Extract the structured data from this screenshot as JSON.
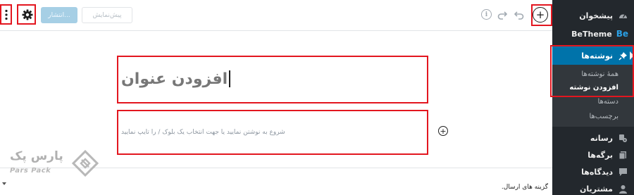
{
  "sidebar": {
    "dashboard": "پیشخوان",
    "betheme": "BeTheme",
    "betheme_badge": "Be",
    "posts": "نوشته‌ها",
    "posts_submenu": [
      "همهٔ نوشته‌ها",
      "افزودن نوشته",
      "دسته‌ها",
      "برچسب‌ها"
    ],
    "media": "رسانه",
    "pages": "برگه‌ها",
    "comments": "دیدگاه‌ها",
    "customers": "مشتریان"
  },
  "toolbar": {
    "add_block_icon": "plus-circle-icon",
    "undo_icon": "undo-icon",
    "redo_icon": "redo-icon",
    "info_icon": "info-icon",
    "outline_icon": "list-icon",
    "publish_label": "انتشار...",
    "preview_label": "پیش‌نمایش",
    "settings_icon": "gear-icon",
    "more_icon": "vertical-ellipsis-icon"
  },
  "editor": {
    "title_placeholder": "افزودن عنوان",
    "block_placeholder": "شروع به نوشتن نمایید یا جهت انتخاب یک بلوک / را تایپ نمایید"
  },
  "bottom": {
    "publish_options": "گزینه های ارسال."
  },
  "watermark": {
    "name_fa": "پارس پک",
    "name_en": "Pars Pack"
  },
  "colors": {
    "sidebar_bg": "#23282d",
    "active_menu": "#0073aa",
    "annotation_red": "#e3161f"
  }
}
